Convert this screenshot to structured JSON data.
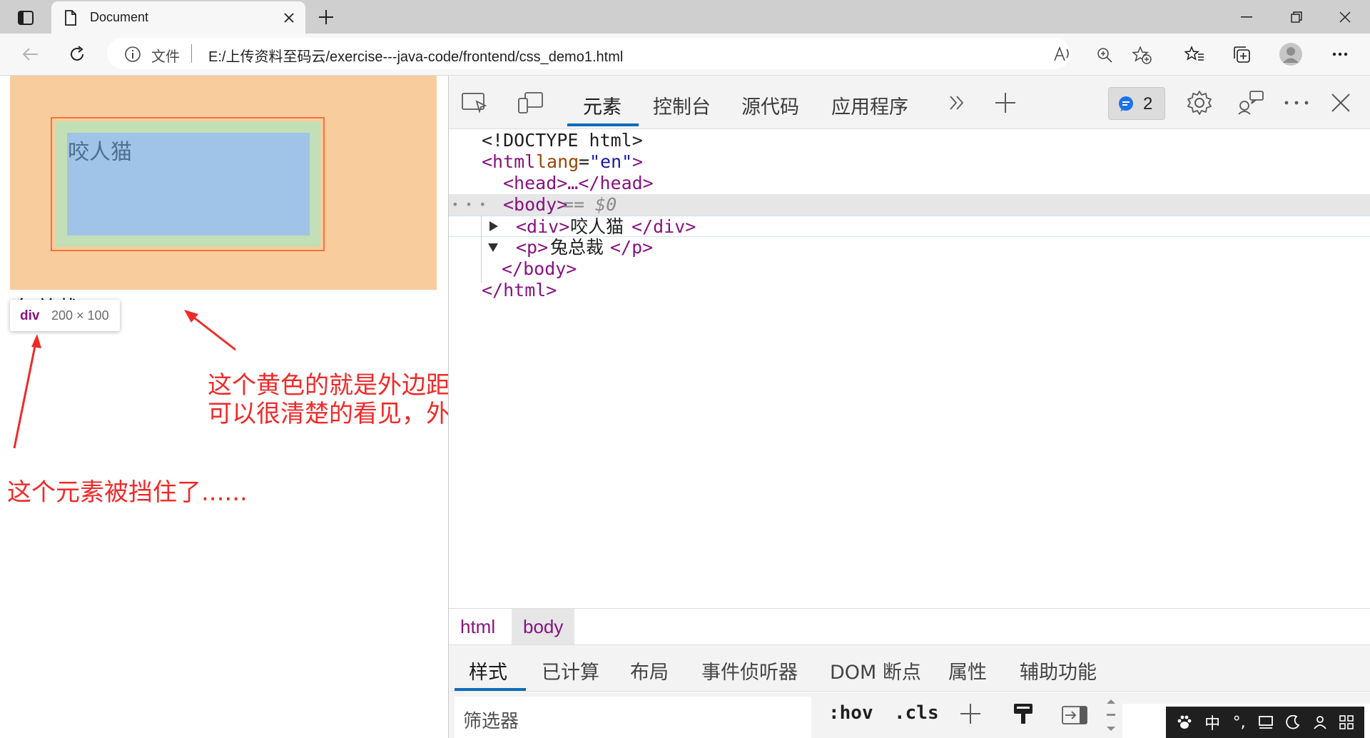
{
  "browser": {
    "tab_title": "Document",
    "address": {
      "file_label": "文件",
      "url": "E:/上传资料至码云/exercise---java-code/frontend/css_demo1.html"
    }
  },
  "page": {
    "div_text": "咬人猫",
    "p_text": "兔总裁",
    "tooltip": {
      "tag": "div",
      "size": "200 × 100"
    },
    "annotations": {
      "margin_line1": "这个黄色的就是外边距，",
      "margin_line2": "可以很清楚的看见，外边距把 两个元素 给分开了",
      "hidden_note": "这个元素被挡住了......"
    },
    "colors": {
      "margin": "#f9cc9d",
      "border": "#f4743a",
      "padding": "#c2dfb5",
      "content": "#9fc4e7",
      "annotation": "#f02a2a"
    }
  },
  "devtools": {
    "tabs": [
      "元素",
      "控制台",
      "源代码",
      "应用程序"
    ],
    "issues_count": "2",
    "dom": {
      "doctype": "<!DOCTYPE html>",
      "html_open": "<html",
      "lang_attr": "lang",
      "lang_val": "\"en\"",
      "gt": ">",
      "head": "<head>…</head>",
      "row_dots": "• • •",
      "body_open": "<body>",
      "selected_marker": "== $0",
      "div_open": "<div>",
      "div_text": "咬人猫",
      "div_close": "</div>",
      "p_open": "<p>",
      "p_text": "兔总裁",
      "p_close": "</p>",
      "body_close": "</body>",
      "html_close": "</html>"
    },
    "breadcrumbs": [
      "html",
      "body"
    ],
    "styles_tabs": [
      "样式",
      "已计算",
      "布局",
      "事件侦听器",
      "DOM 断点",
      "属性",
      "辅助功能"
    ],
    "filter": {
      "placeholder": "筛选器",
      "hov": ":hov",
      "cls": ".cls"
    }
  },
  "ime": {
    "mode": "中",
    "punct": "°,"
  }
}
